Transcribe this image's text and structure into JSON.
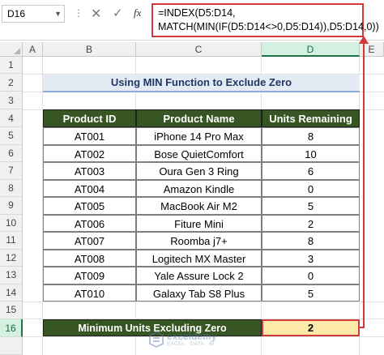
{
  "formula_bar": {
    "name_box": "D16",
    "formula_line1": "=INDEX(D5:D14,",
    "formula_line2": "MATCH(MIN(IF(D5:D14<>0,D5:D14)),D5:D14,0))",
    "cancel_glyph": "✕",
    "enter_glyph": "✓",
    "fx_label": "fx",
    "dots": "⋮"
  },
  "columns": [
    "A",
    "B",
    "C",
    "D",
    "E"
  ],
  "selected_column": "D",
  "rows": [
    "1",
    "2",
    "3",
    "4",
    "5",
    "6",
    "7",
    "8",
    "9",
    "10",
    "11",
    "12",
    "13",
    "14",
    "15",
    "16"
  ],
  "selected_row": "16",
  "title": "Using MIN Function to Exclude Zero",
  "table": {
    "headers": [
      "Product ID",
      "Product Name",
      "Units Remaining"
    ],
    "rows": [
      [
        "AT001",
        "iPhone 14 Pro Max",
        "8"
      ],
      [
        "AT002",
        "Bose QuietComfort",
        "10"
      ],
      [
        "AT003",
        "Oura Gen 3 Ring",
        "6"
      ],
      [
        "AT004",
        "Amazon Kindle",
        "0"
      ],
      [
        "AT005",
        "MacBook Air M2",
        "5"
      ],
      [
        "AT006",
        "Fiture Mini",
        "2"
      ],
      [
        "AT007",
        "Roomba j7+",
        "8"
      ],
      [
        "AT008",
        "Logitech MX Master",
        "3"
      ],
      [
        "AT009",
        "Yale Assure Lock 2",
        "0"
      ],
      [
        "AT010",
        "Galaxy Tab S8 Plus",
        "5"
      ]
    ]
  },
  "summary": {
    "label": "Minimum Units Excluding Zero",
    "value": "2"
  },
  "watermark": {
    "name": "exceldemy",
    "tagline": "EXCEL · DATA · BI"
  },
  "colors": {
    "header_green": "#375623",
    "title_bg": "#e4ebf5",
    "result_bg": "#fde9a8",
    "highlight_red": "#d23a3a"
  }
}
